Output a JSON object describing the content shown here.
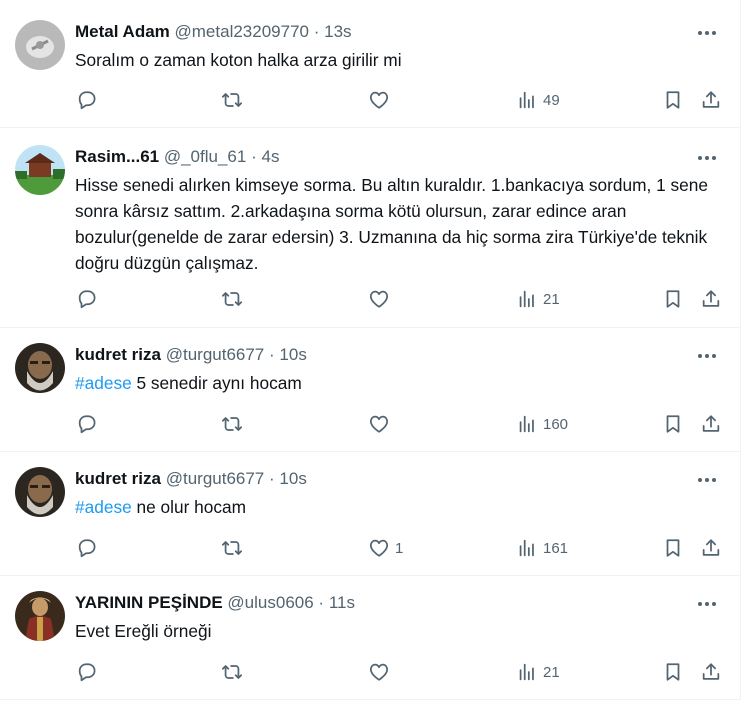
{
  "colors": {
    "text": "#0f1419",
    "secondary": "#536471",
    "accent": "#1d9bf0",
    "divider": "#eff3f4"
  },
  "tweets": [
    {
      "name": "Metal Adam",
      "handle": "@metal23209770",
      "dot": "·",
      "time": "13s",
      "text": "Soralım o zaman koton halka arza girilir mi",
      "likes": "",
      "views": "49",
      "avatar": "gray-logo-avatar"
    },
    {
      "name": "Rasim...61",
      "handle": "@_0flu_61",
      "dot": "·",
      "time": "4s",
      "text": "Hisse senedi alırken kimseye sorma. Bu altın kuraldır. 1.bankacıya sordum, 1 sene sonra kârsız sattım. 2.arkadaşına sorma kötü olursun, zarar edince aran bozulur(genelde de zarar edersin) 3. Uzmanına da hiç sorma zira Türkiye'de teknik doğru düzgün çalışmaz.",
      "likes": "",
      "views": "21",
      "avatar": "garden-gazebo-avatar"
    },
    {
      "name": "kudret riza",
      "handle": "@turgut6677",
      "dot": "·",
      "time": "10s",
      "hashtag": "#adese",
      "text": " 5 senedir aynı hocam",
      "likes": "",
      "views": "160",
      "avatar": "bearded-man-avatar"
    },
    {
      "name": "kudret riza",
      "handle": "@turgut6677",
      "dot": "·",
      "time": "10s",
      "hashtag": "#adese",
      "text": " ne olur hocam",
      "likes": "1",
      "views": "161",
      "avatar": "bearded-man-avatar"
    },
    {
      "name": "YARININ PEŞİNDE",
      "handle": "@ulus0606",
      "dot": "·",
      "time": "11s",
      "text": "Evet Ereğli örneği",
      "likes": "",
      "views": "21",
      "avatar": "historical-figure-avatar"
    }
  ]
}
